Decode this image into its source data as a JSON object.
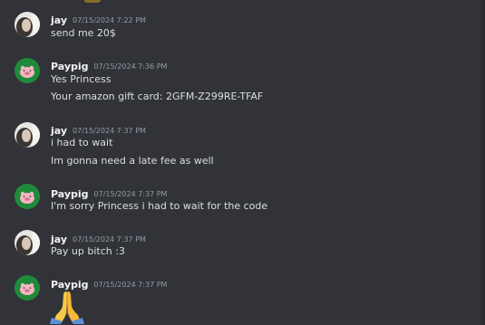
{
  "messages": [
    {
      "author": "jay",
      "time": "07/15/2024 7:22 PM",
      "avatar_icon": "profile-photo-icon",
      "lines": [
        "send me 20$"
      ]
    },
    {
      "author": "Paypig",
      "time": "07/15/2024 7:36 PM",
      "avatar_icon": "pig-icon",
      "lines": [
        "Yes Princess",
        "Your amazon gift card: 2GFM-Z299RE-TFAF"
      ]
    },
    {
      "author": "jay",
      "time": "07/15/2024 7:37 PM",
      "avatar_icon": "profile-photo-icon",
      "lines": [
        "i had to wait",
        "Im gonna need a late fee as well"
      ]
    },
    {
      "author": "Paypig",
      "time": "07/15/2024 7:37 PM",
      "avatar_icon": "pig-icon",
      "lines": [
        "I'm sorry Princess i had to wait for the code"
      ]
    },
    {
      "author": "jay",
      "time": "07/15/2024 7:37 PM",
      "avatar_icon": "profile-photo-icon",
      "lines": [
        "Pay up bitch :3"
      ]
    },
    {
      "author": "Paypig",
      "time": "07/15/2024 7:37 PM",
      "avatar_icon": "pig-icon",
      "lines": [],
      "emoji_icon": "folded-hands-icon"
    }
  ],
  "colors": {
    "background": "#313338",
    "username": "#f2f3f5",
    "timestamp": "#949ba4",
    "message_text": "#dbdee1",
    "pig_avatar_bg": "#1f8b3a"
  }
}
